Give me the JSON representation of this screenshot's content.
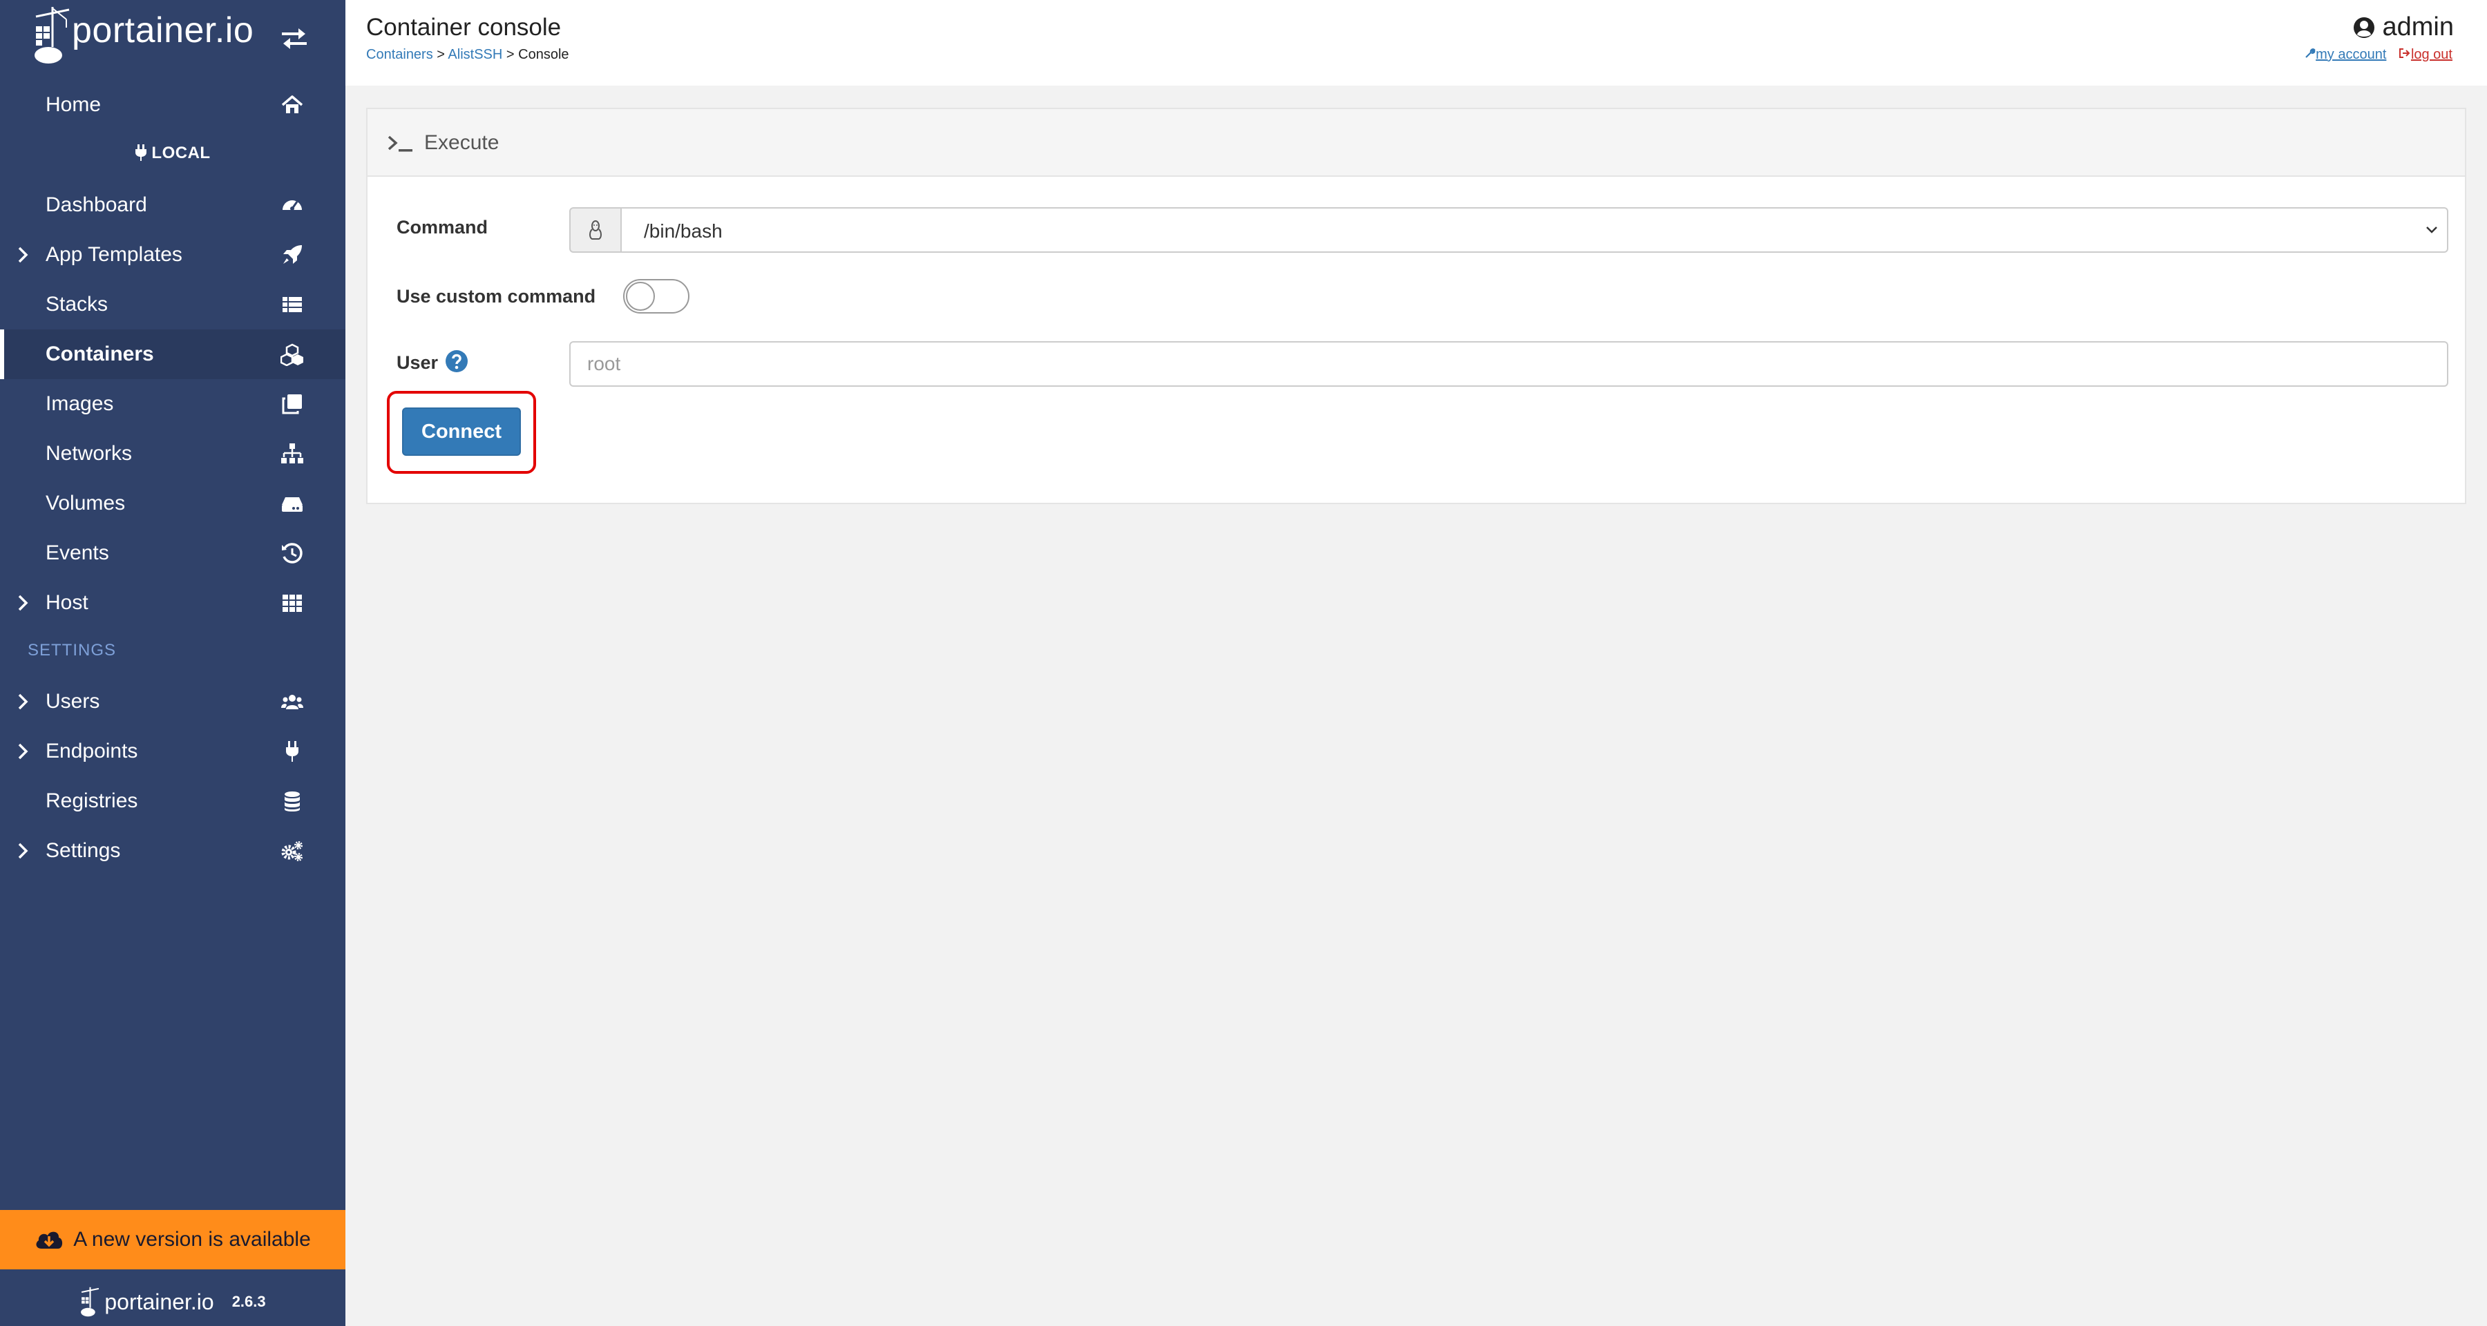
{
  "brand": {
    "name": "portainer.io",
    "footer_name": "portainer.io",
    "version": "2.6.3"
  },
  "sidebar": {
    "endpoint_label": "LOCAL",
    "section_settings": "SETTINGS",
    "items": {
      "home": {
        "label": "Home",
        "icon": "home-icon"
      },
      "dashboard": {
        "label": "Dashboard",
        "icon": "dashboard-icon"
      },
      "app_templates": {
        "label": "App Templates",
        "icon": "rocket-icon"
      },
      "stacks": {
        "label": "Stacks",
        "icon": "list-icon"
      },
      "containers": {
        "label": "Containers",
        "icon": "cubes-icon",
        "active": true
      },
      "images": {
        "label": "Images",
        "icon": "clone-icon"
      },
      "networks": {
        "label": "Networks",
        "icon": "sitemap-icon"
      },
      "volumes": {
        "label": "Volumes",
        "icon": "hdd-icon"
      },
      "events": {
        "label": "Events",
        "icon": "history-icon"
      },
      "host": {
        "label": "Host",
        "icon": "th-icon"
      },
      "users": {
        "label": "Users",
        "icon": "users-icon"
      },
      "endpoints": {
        "label": "Endpoints",
        "icon": "plug-icon"
      },
      "registries": {
        "label": "Registries",
        "icon": "database-icon"
      },
      "settings": {
        "label": "Settings",
        "icon": "cogs-icon"
      }
    },
    "update_banner": "A new version is available"
  },
  "header": {
    "title": "Container console",
    "breadcrumb": {
      "containers": "Containers",
      "sep1": ">",
      "container": "AlistSSH",
      "sep2": ">",
      "current": "Console"
    },
    "user": "admin",
    "my_account": "my account",
    "log_out": "log out"
  },
  "panel": {
    "title": "Execute",
    "command_label": "Command",
    "command_value": "/bin/bash",
    "custom_command_label": "Use custom command",
    "custom_command_enabled": false,
    "user_label": "User",
    "user_placeholder": "root",
    "user_value": "",
    "connect_label": "Connect"
  },
  "colors": {
    "sidebar_bg": "#30426a",
    "accent": "#337ab7",
    "banner": "#ff8c1a",
    "highlight": "#e30000"
  }
}
